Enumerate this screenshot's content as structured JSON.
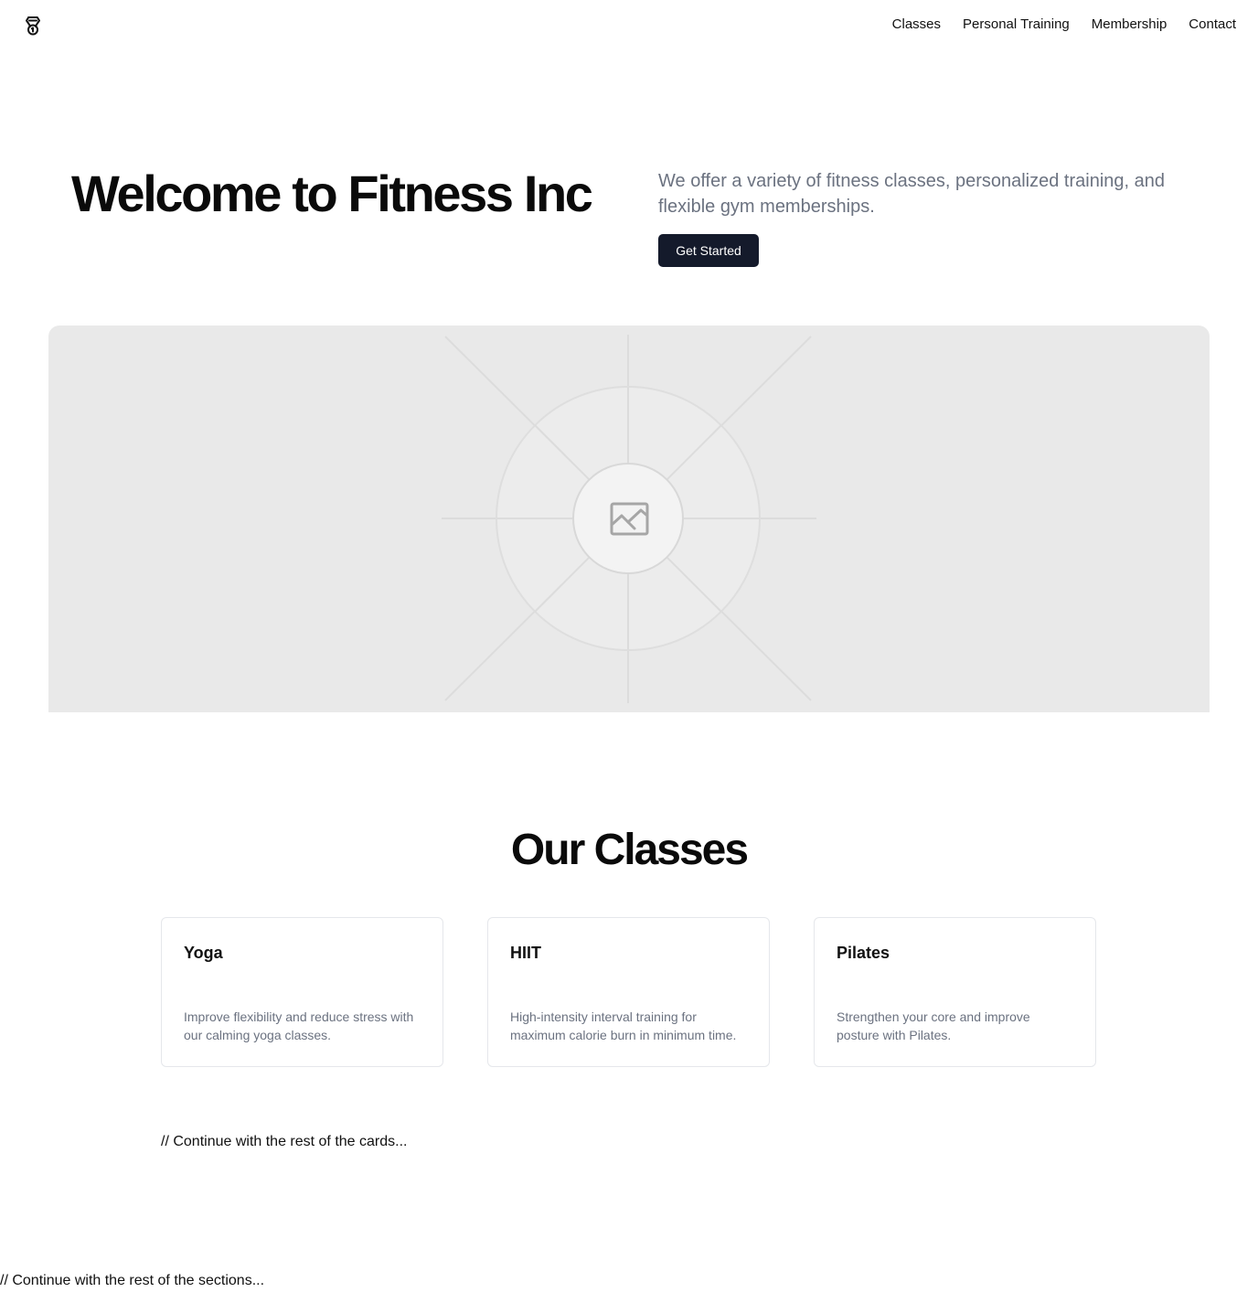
{
  "header": {
    "nav": [
      {
        "label": "Classes"
      },
      {
        "label": "Personal Training"
      },
      {
        "label": "Membership"
      },
      {
        "label": "Contact"
      }
    ]
  },
  "hero": {
    "title": "Welcome to Fitness Inc",
    "description": "We offer a variety of fitness classes, personalized training, and flexible gym memberships.",
    "cta_label": "Get Started",
    "image_icon": "image-placeholder-icon"
  },
  "classes": {
    "title": "Our Classes",
    "cards": [
      {
        "title": "Yoga",
        "description": "Improve flexibility and reduce stress with our calming yoga classes."
      },
      {
        "title": "HIIT",
        "description": "High-intensity interval training for maximum calorie burn in minimum time."
      },
      {
        "title": "Pilates",
        "description": "Strengthen your core and improve posture with Pilates."
      }
    ],
    "continue_note": "// Continue with the rest of the cards..."
  },
  "footer_note": "// Continue with the rest of the sections...",
  "colors": {
    "button_bg": "#141a2b",
    "muted_text": "#6b7280",
    "placeholder_bg": "#e9e9e9",
    "card_border": "#e5e7eb"
  }
}
